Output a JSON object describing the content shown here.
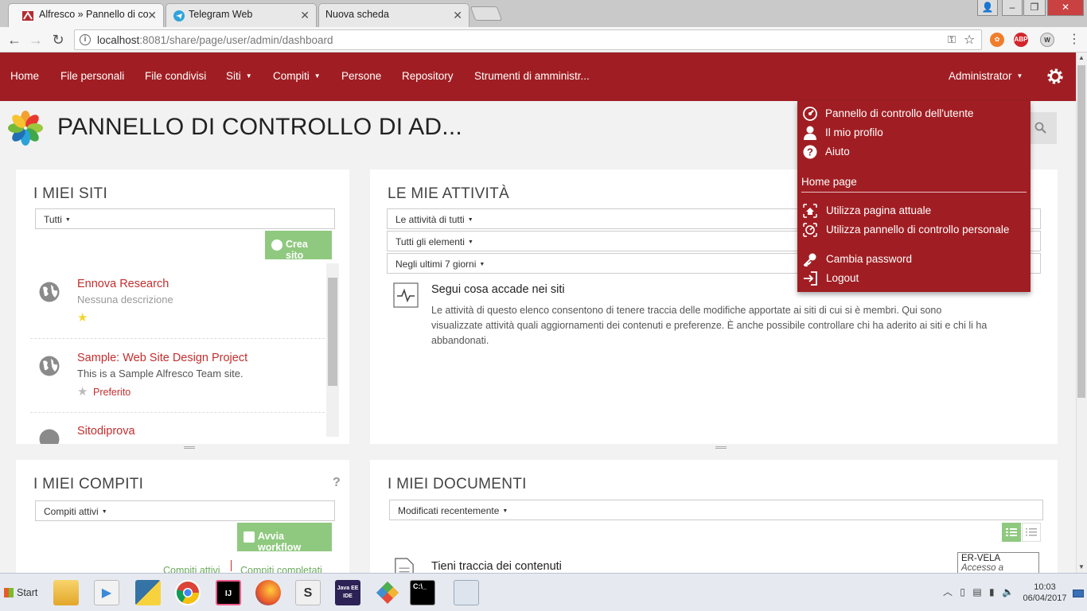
{
  "browser": {
    "tabs": [
      {
        "label": "Alfresco » Pannello di co",
        "icon": "alfresco-favicon",
        "active": true
      },
      {
        "label": "Telegram Web",
        "icon": "telegram-favicon",
        "active": false
      },
      {
        "label": "Nuova scheda",
        "icon": "",
        "active": false
      }
    ],
    "url_host": "localhost",
    "url_rest": ":8081/share/page/user/admin/dashboard",
    "extensions": [
      "ABP",
      "W"
    ]
  },
  "nav": {
    "home": "Home",
    "my_files": "File personali",
    "shared_files": "File condivisi",
    "sites": "Siti",
    "tasks": "Compiti",
    "people": "Persone",
    "repository": "Repository",
    "admin_tools": "Strumenti di amministr...",
    "user": "Administrator"
  },
  "page": {
    "title": "PANNELLO DI CONTROLLO DI AD..."
  },
  "my_sites": {
    "title": "I MIEI SITI",
    "filter": "Tutti",
    "create_button": "Crea sito",
    "sites": [
      {
        "name": "Ennova Research",
        "description": "Nessuna descrizione",
        "favorite_label": ""
      },
      {
        "name": "Sample: Web Site Design Project",
        "description": "This is a Sample Alfresco Team site.",
        "favorite_label": "Preferito"
      },
      {
        "name": "Sitodiprova",
        "description": "",
        "favorite_label": ""
      }
    ]
  },
  "my_activities": {
    "title": "LE MIE ATTIVITÀ",
    "filters": [
      "Le attività di tutti",
      "Tutti gli elementi",
      "Negli ultimi 7 giorni"
    ],
    "empty_title": "Segui cosa accade nei siti",
    "empty_text_1": "Le attività di questo elenco consentono di tenere traccia delle modifiche apportate ai siti di cui si è membri. Qui sono",
    "empty_text_2": "visualizzate attività quali aggiornamenti dei contenuti e preferenze. È anche possibile controllare chi ha aderito ai siti e chi li ha",
    "empty_text_3": "abbandonati."
  },
  "my_tasks": {
    "title": "I MIEI COMPITI",
    "help": "?",
    "filter": "Compiti attivi",
    "workflow_button": "Avvia workflow",
    "link_active": "Compiti attivi",
    "link_completed": "Compiti completati"
  },
  "my_documents": {
    "title": "I MIEI DOCUMENTI",
    "filter": "Modificati recentemente",
    "empty_title": "Tieni traccia dei contenuti"
  },
  "user_menu": {
    "items_top": [
      {
        "label": "Pannello di controllo dell'utente",
        "icon": "dashboard-icon"
      },
      {
        "label": "Il mio profilo",
        "icon": "user-icon"
      },
      {
        "label": "Aiuto",
        "icon": "help-icon"
      }
    ],
    "section_label": "Home page",
    "items_home": [
      {
        "label": "Utilizza pagina attuale",
        "icon": "home-page-icon"
      },
      {
        "label": "Utilizza pannello di controllo personale",
        "icon": "home-dashboard-icon"
      }
    ],
    "items_bottom": [
      {
        "label": "Cambia password",
        "icon": "key-icon"
      },
      {
        "label": "Logout",
        "icon": "logout-icon"
      }
    ]
  },
  "tooltip": {
    "title": "ER-VELA",
    "subtitle": "Accesso a Internet"
  },
  "taskbar": {
    "start_label": "Start",
    "time": "10:03",
    "date": "06/04/2017",
    "apps": [
      "explorer",
      "media",
      "python",
      "chrome",
      "intellij",
      "firefox",
      "sublime",
      "java-ee-ide",
      "git",
      "cmd",
      "settings"
    ],
    "java_label": "Java EE IDE",
    "intellij_label": "IJ",
    "sublime_label": "S",
    "cmd_label": "C:\\_"
  },
  "colors": {
    "brand_red": "#a01e23",
    "link_red": "#c42e2e",
    "button_green": "#8fc97f"
  }
}
